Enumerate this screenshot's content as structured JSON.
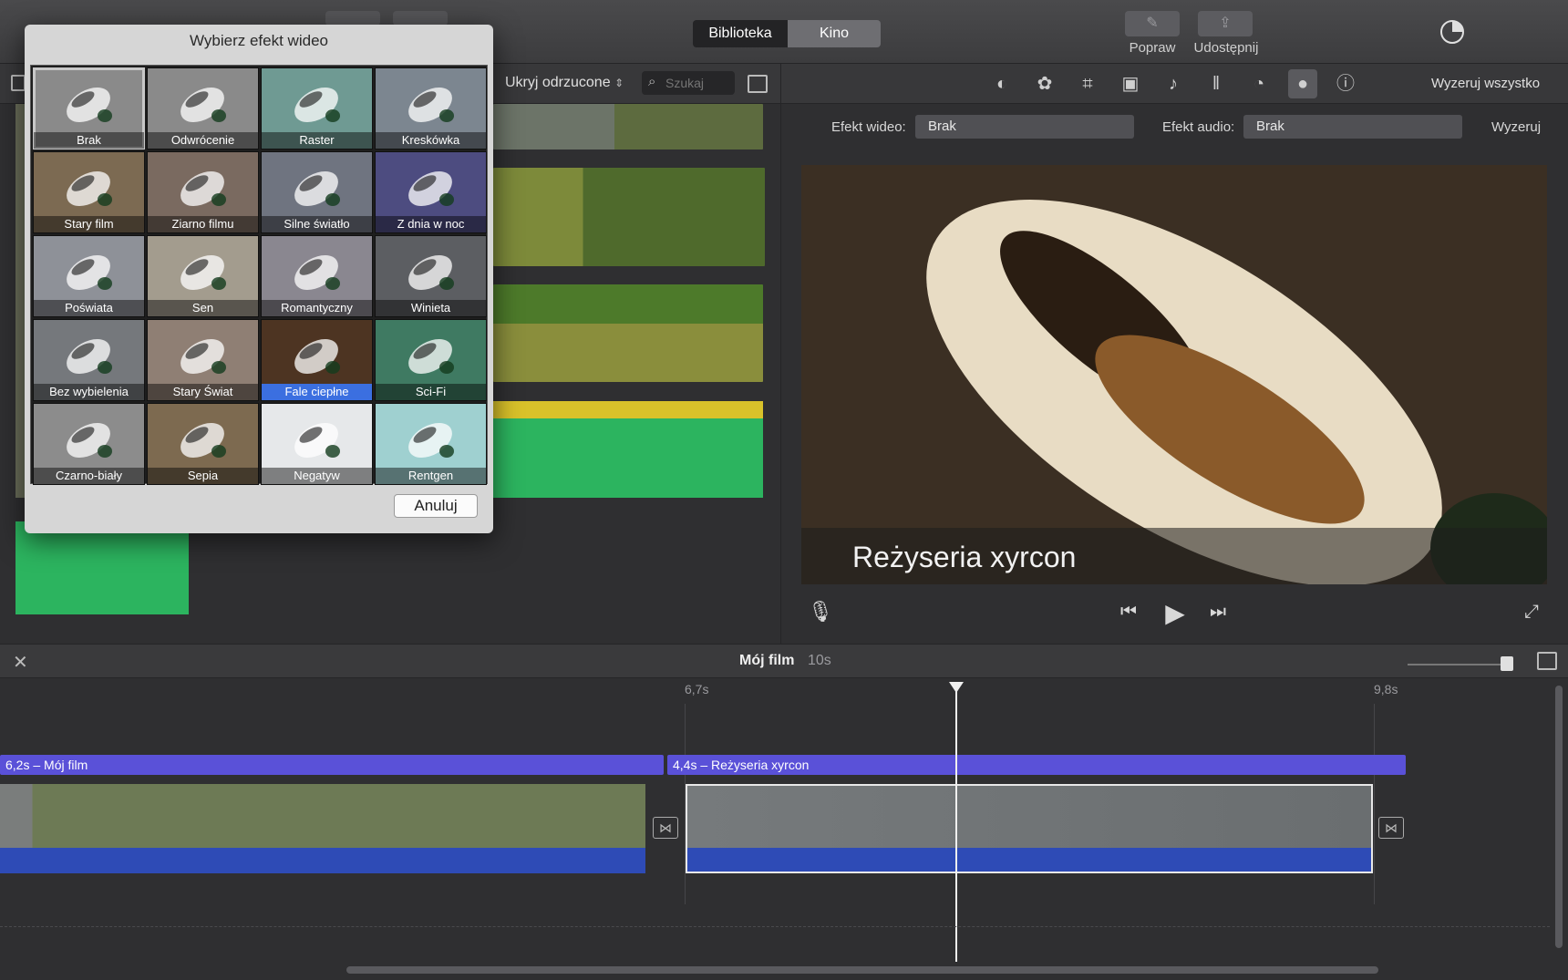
{
  "toolbar": {
    "library_label": "Biblioteka",
    "theater_label": "Kino",
    "enhance_label": "Popraw",
    "share_label": "Udostępnij"
  },
  "browser": {
    "filter_label": "Ukryj odrzucone",
    "search_placeholder": "Szukaj"
  },
  "adjust": {
    "reset_all_label": "Wyzeruj wszystko",
    "icons": [
      "color-balance-icon",
      "color-correction-icon",
      "crop-icon",
      "stabilization-icon",
      "volume-icon",
      "equalizer-icon",
      "speed-icon",
      "clip-filter-icon",
      "info-icon"
    ]
  },
  "effects": {
    "video_label": "Efekt wideo:",
    "video_value": "Brak",
    "audio_label": "Efekt audio:",
    "audio_value": "Brak",
    "reset_label": "Wyzeruj"
  },
  "viewer": {
    "title_overlay": "Reżyseria xyrcon"
  },
  "dialog": {
    "title": "Wybierz efekt wideo",
    "cancel_label": "Anuluj",
    "effects": [
      {
        "name": "Brak",
        "tint": "#8a8a8a"
      },
      {
        "name": "Odwrócenie",
        "tint": "#8a8a8a"
      },
      {
        "name": "Raster",
        "tint": "#6f9a93"
      },
      {
        "name": "Kreskówka",
        "tint": "#7c8690"
      },
      {
        "name": "Stary film",
        "tint": "#7c6a52"
      },
      {
        "name": "Ziarno filmu",
        "tint": "#7a6a60"
      },
      {
        "name": "Silne światło",
        "tint": "#6f7480"
      },
      {
        "name": "Z dnia w noc",
        "tint": "#4d4c80"
      },
      {
        "name": "Poświata",
        "tint": "#8e9198"
      },
      {
        "name": "Sen",
        "tint": "#a39c8e"
      },
      {
        "name": "Romantyczny",
        "tint": "#8a8790"
      },
      {
        "name": "Winieta",
        "tint": "#5c5e62"
      },
      {
        "name": "Bez wybielenia",
        "tint": "#75787c"
      },
      {
        "name": "Stary Świat",
        "tint": "#8f7f74"
      },
      {
        "name": "Fale ciepłne",
        "tint": "#4d3422"
      },
      {
        "name": "Sci-Fi",
        "tint": "#3f7a62"
      },
      {
        "name": "Czarno-biały",
        "tint": "#8c8c8c"
      },
      {
        "name": "Sepia",
        "tint": "#7d6a50"
      },
      {
        "name": "Negatyw",
        "tint": "#e6e8ea"
      },
      {
        "name": "Rentgen",
        "tint": "#9fd0d0"
      }
    ],
    "current_index": 0,
    "selected_index": 14
  },
  "timeline": {
    "project_title": "Mój film",
    "project_duration": "10s",
    "ruler_start": "6,7s",
    "ruler_end": "9,8s",
    "clip1_title": "6,2s – Mój film",
    "clip2_title": "4,4s –  Reżyseria xyrcon"
  },
  "colors": {
    "title_clip": "#5a51d8",
    "audio": "#2e4bb6",
    "waveform": "#2cb45f",
    "selection": "#3b6fe0"
  }
}
